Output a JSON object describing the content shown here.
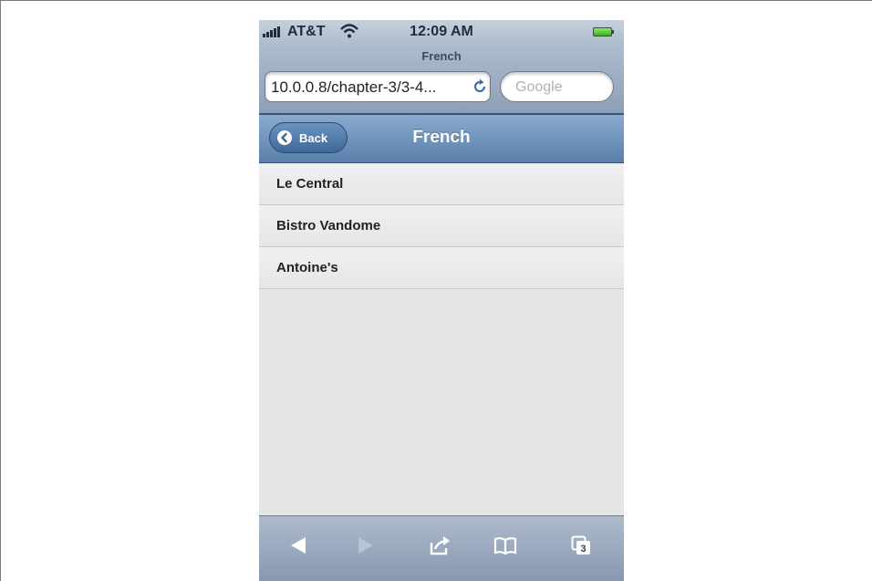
{
  "status_bar": {
    "carrier": "AT&T",
    "time": "12:09 AM"
  },
  "safari": {
    "page_title": "French",
    "url": "10.0.0.8/chapter-3/3-4...",
    "search_placeholder": "Google"
  },
  "app_toolbar": {
    "back_label": "Back",
    "title": "French"
  },
  "list": {
    "items": [
      "Le Central",
      "Bistro Vandome",
      "Antoine's"
    ]
  },
  "bottom_toolbar": {
    "tab_count": "3"
  },
  "icons": [
    "signal-icon",
    "wifi-icon",
    "battery-icon",
    "reload-icon",
    "back-arrow-icon",
    "nav-back-icon",
    "nav-forward-icon",
    "share-icon",
    "bookmarks-icon",
    "pages-icon"
  ],
  "colors": {
    "navbar_blue": "#5a7faa",
    "list_bg": "#e5e5e5"
  }
}
